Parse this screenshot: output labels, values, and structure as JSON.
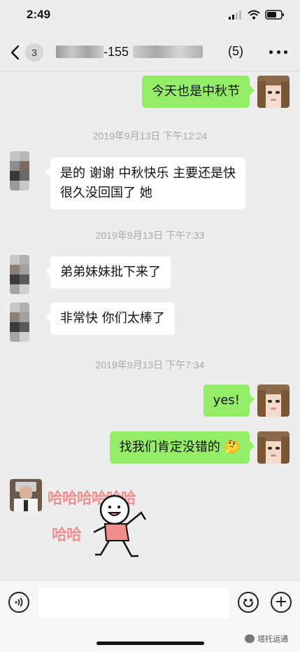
{
  "status_bar": {
    "time": "2:49"
  },
  "header": {
    "unread_count": "3",
    "title_visible_fragment": "-155",
    "member_count": "(5)"
  },
  "messages": [
    {
      "side": "out",
      "text": "今天也是中秋节"
    },
    {
      "timestamp": "2019年9月13日 下午12:24"
    },
    {
      "side": "in",
      "lines": [
        "是的 谢谢 中秋快乐 主要还是快",
        "很久没回国了 她"
      ]
    },
    {
      "timestamp": "2019年9月13日 下午7:33"
    },
    {
      "side": "in",
      "text": "弟弟妹妹批下来了"
    },
    {
      "side": "in",
      "text": "非常快 你们太棒了"
    },
    {
      "timestamp": "2019年9月13日 下午7:34"
    },
    {
      "side": "out",
      "text": "yes!"
    },
    {
      "side": "out",
      "text": "找我们肯定没错的 🤔"
    },
    {
      "side": "in",
      "sticker": {
        "line1": "哈哈哈哈哈哈",
        "line2": "哈哈"
      }
    }
  ],
  "input_bar": {
    "placeholder": ""
  },
  "watermark": "塔托运通",
  "colors": {
    "outgoing_bubble": "#95ec69",
    "incoming_bubble": "#ffffff",
    "background": "#ededed"
  }
}
